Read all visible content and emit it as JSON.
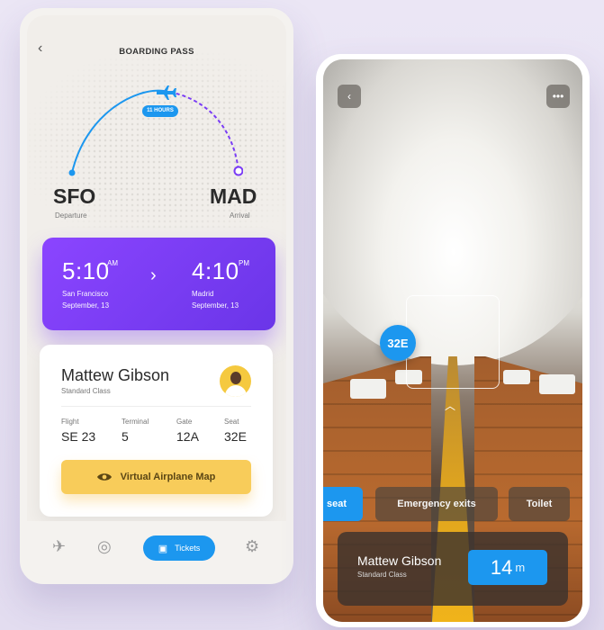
{
  "left_phone": {
    "title": "BOARDING PASS",
    "duration": "11 HOURS",
    "departure": {
      "code": "SFO",
      "label": "Departure"
    },
    "arrival": {
      "code": "MAD",
      "label": "Arrival"
    },
    "time_card": {
      "dep_time": "5:10",
      "dep_ampm": "AM",
      "dep_city": "San Francisco",
      "dep_date": "September, 13",
      "arr_time": "4:10",
      "arr_ampm": "PM",
      "arr_city": "Madrid",
      "arr_date": "September, 13"
    },
    "passenger": {
      "name": "Mattew Gibson",
      "class": "Standard Class",
      "flight_label": "Flight",
      "flight_value": "SE 23",
      "terminal_label": "Terminal",
      "terminal_value": "5",
      "gate_label": "Gate",
      "gate_value": "12A",
      "seat_label": "Seat",
      "seat_value": "32E"
    },
    "map_button": "Virtual Airplane Map",
    "tabbar": {
      "active_label": "Tickets"
    },
    "colors": {
      "accent": "#1c97ef",
      "purple": "#7a3cf5",
      "yellow": "#f8cc5a"
    }
  },
  "right_phone": {
    "seat_bubble": "32E",
    "pills": [
      "seat",
      "Emergency exits",
      "Toilet"
    ],
    "bottom_card": {
      "name": "Mattew Gibson",
      "class": "Standard Class",
      "distance": "14",
      "unit": "m"
    }
  }
}
